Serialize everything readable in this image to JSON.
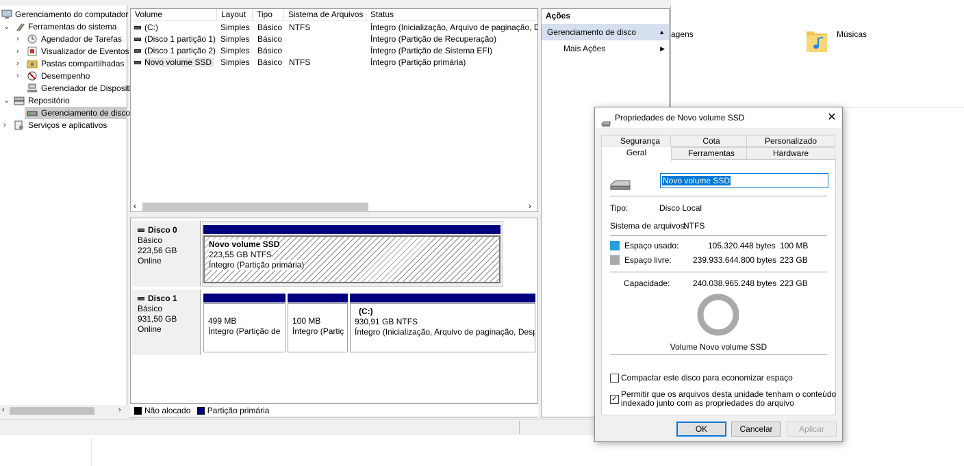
{
  "explorer_bg": {
    "items": [
      {
        "label": "agens"
      },
      {
        "label": "Músicas"
      }
    ]
  },
  "tree": {
    "items": [
      {
        "label": "Gerenciamento do computador",
        "level": 0
      },
      {
        "label": "Ferramentas do sistema",
        "level": 1
      },
      {
        "label": "Agendador de Tarefas",
        "level": 2
      },
      {
        "label": "Visualizador de Eventos",
        "level": 2
      },
      {
        "label": "Pastas compartilhadas",
        "level": 2
      },
      {
        "label": "Desempenho",
        "level": 2
      },
      {
        "label": "Gerenciador de Dispositivos",
        "level": 2
      },
      {
        "label": "Repositório",
        "level": 1
      },
      {
        "label": "Gerenciamento de disco",
        "level": 2
      },
      {
        "label": "Serviços e aplicativos",
        "level": 1
      }
    ]
  },
  "volume_list": {
    "columns": [
      "Volume",
      "Layout",
      "Tipo",
      "Sistema de Arquivos",
      "Status"
    ],
    "rows": [
      {
        "volume": "(C:)",
        "layout": "Simples",
        "tipo": "Básico",
        "fs": "NTFS",
        "status": "Íntegro (Inicialização, Arquivo de paginação, D"
      },
      {
        "volume": "(Disco 1 partição 1)",
        "layout": "Simples",
        "tipo": "Básico",
        "fs": "",
        "status": "Íntegro (Partição de Recuperação)"
      },
      {
        "volume": "(Disco 1 partição 2)",
        "layout": "Simples",
        "tipo": "Básico",
        "fs": "",
        "status": "Íntegro (Partição de Sistema EFI)"
      },
      {
        "volume": "Novo volume SSD",
        "layout": "Simples",
        "tipo": "Básico",
        "fs": "NTFS",
        "status": "Íntegro (Partição primária)"
      }
    ]
  },
  "disks": [
    {
      "name": "Disco 0",
      "type": "Básico",
      "size": "223,56 GB",
      "state": "Online",
      "partitions": [
        {
          "title": "Novo volume SSD",
          "line1": "223,55 GB NTFS",
          "line2": "Íntegro (Partição primária)"
        }
      ]
    },
    {
      "name": "Disco 1",
      "type": "Básico",
      "size": "931,50 GB",
      "state": "Online",
      "partitions": [
        {
          "title": "",
          "line1": "499 MB",
          "line2": "Íntegro (Partição de"
        },
        {
          "title": "",
          "line1": "100 MB",
          "line2": "Íntegro (Partiç"
        },
        {
          "title": "(C:)",
          "line1": "930,91 GB NTFS",
          "line2": "Íntegro (Inicialização, Arquivo de paginação, Desp"
        }
      ]
    }
  ],
  "legend": {
    "unallocated": "Não alocado",
    "primary": "Partição primária",
    "unallocated_color": "#000000",
    "primary_color": "#00007f"
  },
  "actions": {
    "header": "Ações",
    "section": "Gerenciamento de disco",
    "more": "Mais Ações"
  },
  "dialog": {
    "title": "Propriedades de Novo volume SSD",
    "tabs_top": [
      "Segurança",
      "Cota",
      "Personalizado"
    ],
    "tabs_bottom": [
      "Geral",
      "Ferramentas",
      "Hardware"
    ],
    "name_value": "Novo volume SSD",
    "tipo_label": "Tipo:",
    "tipo_value": "Disco Local",
    "fs_label": "Sistema de arquivos:",
    "fs_value": "NTFS",
    "used_label": "Espaço usado:",
    "used_bytes": "105.320.448 bytes",
    "used_size": "100 MB",
    "free_label": "Espaço livre:",
    "free_bytes": "239.933.644.800 bytes",
    "free_size": "223 GB",
    "cap_label": "Capacidade:",
    "cap_bytes": "240.038.965.248 bytes",
    "cap_size": "223 GB",
    "used_fraction": 0.0004,
    "used_color": "#26a0da",
    "free_color": "#a9a9a9",
    "volume_caption": "Volume Novo volume SSD",
    "compress_label": "Compactar este disco para economizar espaço",
    "compress_checked": false,
    "index_label_1": "Permitir que os arquivos desta unidade tenham o conteúdo",
    "index_label_2": "indexado junto com as propriedades do arquivo",
    "index_checked": true,
    "ok": "OK",
    "cancel": "Cancelar",
    "apply": "Aplicar"
  }
}
